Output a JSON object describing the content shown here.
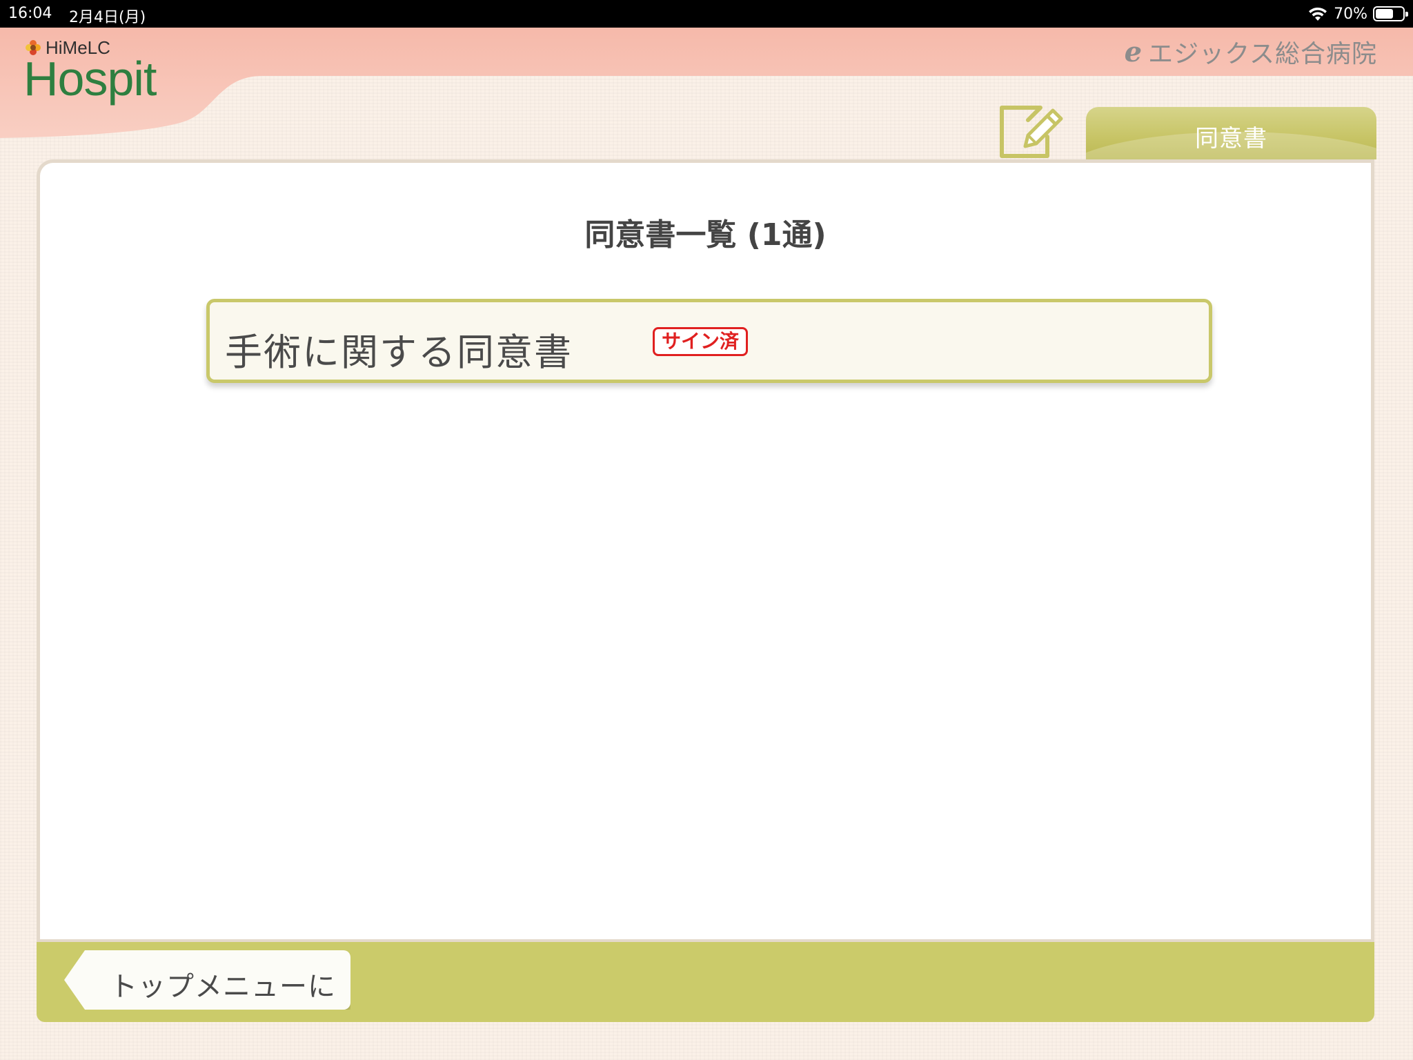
{
  "status_bar": {
    "time": "16:04",
    "date": "2月4日(月)",
    "battery_percent": "70%",
    "battery_level": 0.7,
    "icons": [
      "wifi-icon",
      "battery-icon"
    ]
  },
  "header": {
    "brand_small": "HiMeLC",
    "brand_big": "Hospit",
    "brand_color": "#2e7f40",
    "hospital_logo": "e",
    "hospital_name": "エジックス総合病院"
  },
  "tabs": [
    {
      "label": "同意書",
      "icon": "document-edit-icon",
      "active": true
    }
  ],
  "main": {
    "title": "同意書一覧 (1通)",
    "documents": [
      {
        "title": "手術に関する同意書",
        "badge": "サイン済",
        "badge_color": "#e02020"
      }
    ]
  },
  "footer": {
    "back_label": "トップメニューに戻る"
  },
  "colors": {
    "accent": "#cbcb6a",
    "header_pink": "#f7c2b4",
    "background": "#fbf1e8"
  }
}
